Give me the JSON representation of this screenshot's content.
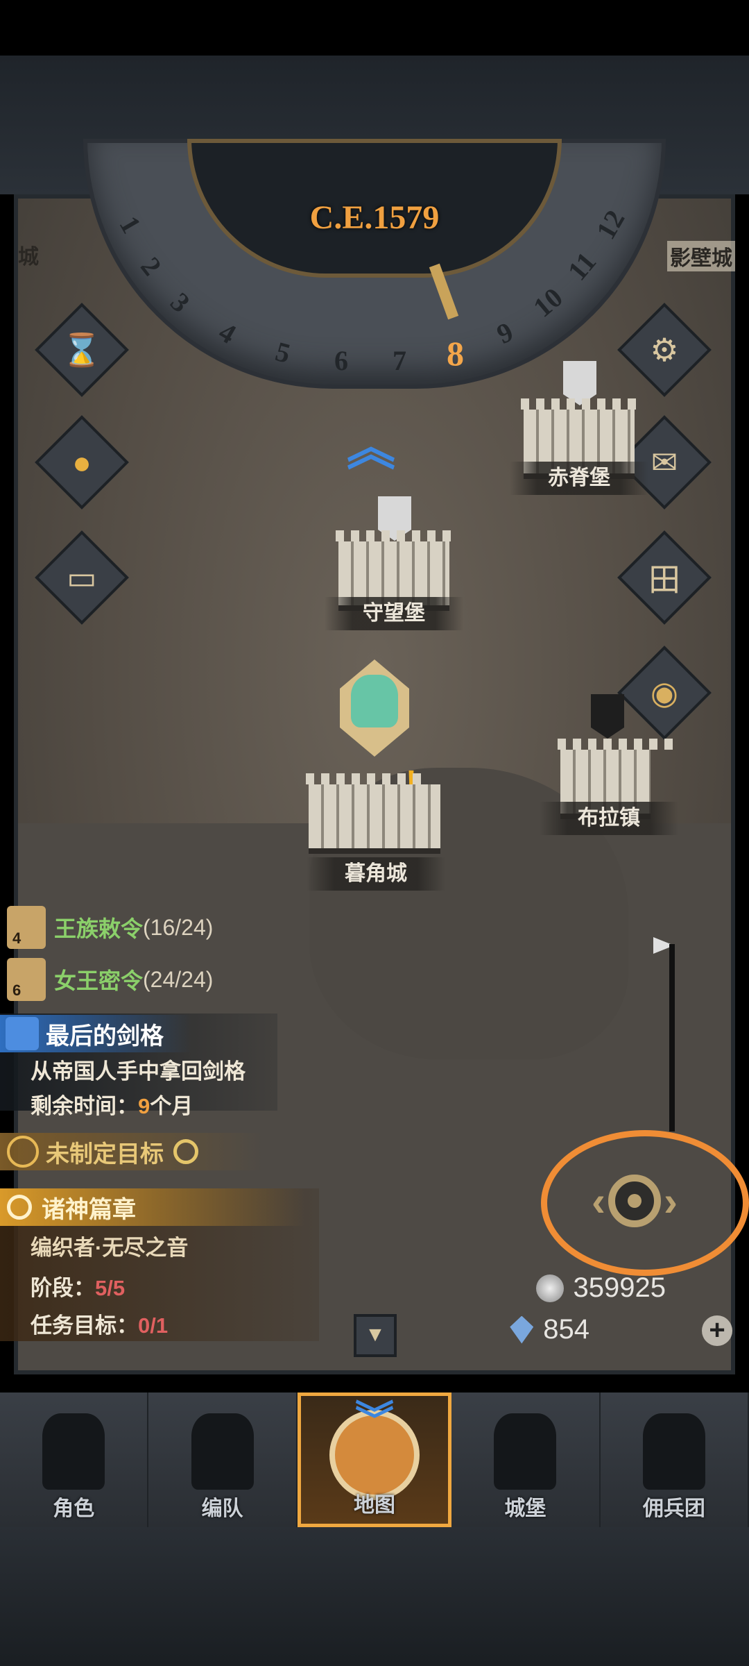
{
  "calendar": {
    "year": "C.E.1579",
    "months": [
      "1",
      "2",
      "3",
      "4",
      "5",
      "6",
      "7",
      "8",
      "9",
      "10",
      "11",
      "12"
    ],
    "active_month": "8"
  },
  "map": {
    "locations": [
      {
        "name": "赤脊堡",
        "flag": "white"
      },
      {
        "name": "守望堡",
        "flag": "white"
      },
      {
        "name": "布拉镇",
        "flag": "black"
      },
      {
        "name": "暮角城",
        "flag": "hero"
      }
    ],
    "edge_labels": {
      "left": "城",
      "right": "影壁城"
    }
  },
  "side_buttons": {
    "left": [
      "hourglass-icon",
      "money-bag-icon",
      "scroll-icon"
    ],
    "right": [
      "gear-icon",
      "mail-icon",
      "gate-icon",
      "coin-icon"
    ]
  },
  "quests": {
    "royal": {
      "badge": "4",
      "title": "王族敕令",
      "progress": "(16/24)"
    },
    "queen": {
      "badge": "6",
      "title": "女王密令",
      "progress": "(24/24)"
    },
    "main": {
      "title": "最后的剑格",
      "description": "从帝国人手中拿回剑格",
      "time_label": "剩余时间：",
      "time_value": "9",
      "time_unit": "个月"
    },
    "target": {
      "title": "未制定目标"
    },
    "gods": {
      "title": "诸神篇章",
      "subtitle": "编织者·无尽之音",
      "stage_label": "阶段：",
      "stage_value": "5/5",
      "goal_label": "任务目标：",
      "goal_value": "0/1"
    }
  },
  "resources": {
    "silver": "359925",
    "gems": "854"
  },
  "nav": {
    "items": [
      "角色",
      "编队",
      "地图",
      "城堡",
      "佣兵团"
    ],
    "active": "地图"
  },
  "colors": {
    "accent_orange": "#f08d35",
    "year_gold": "#f0a040",
    "quest_green": "#8bd06a",
    "stage_red": "#e06060"
  }
}
